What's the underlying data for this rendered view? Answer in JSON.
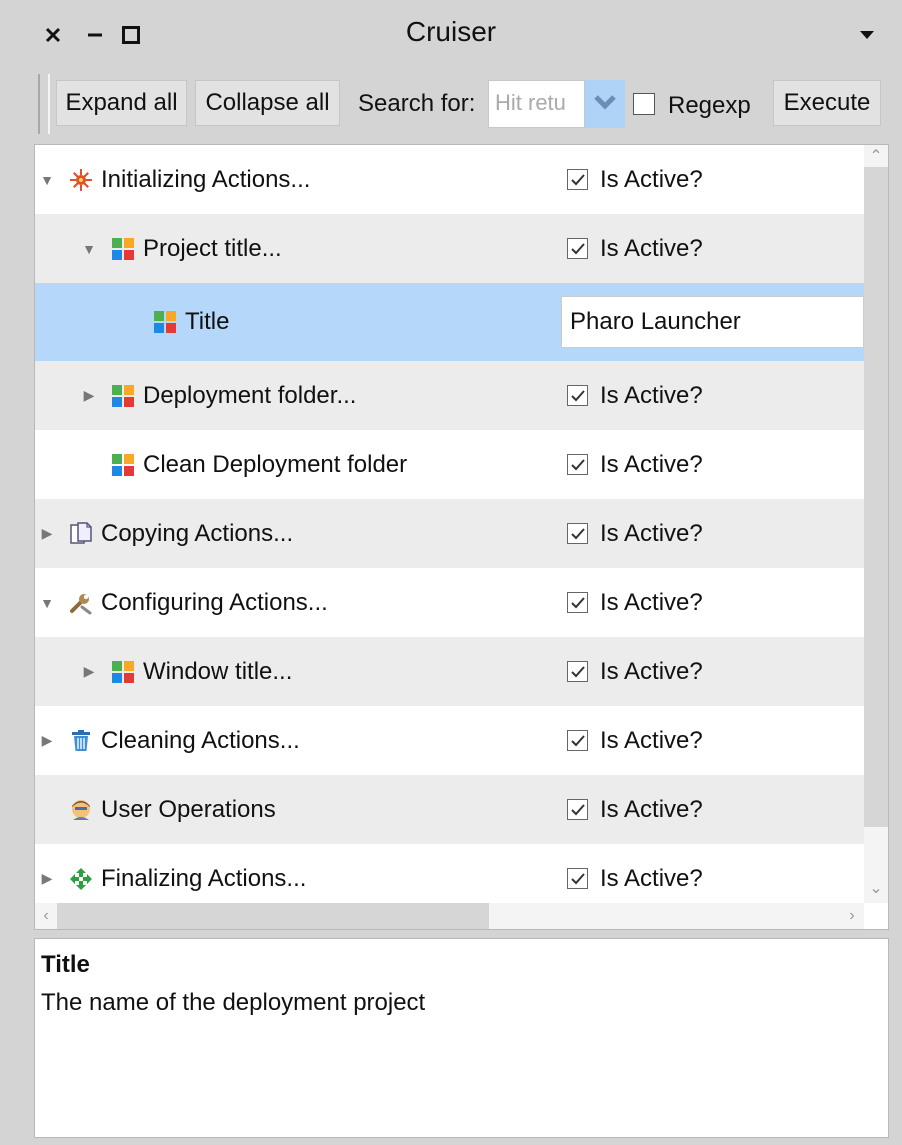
{
  "window": {
    "title": "Cruiser"
  },
  "toolbar": {
    "expand_all": "Expand all",
    "collapse_all": "Collapse all",
    "search_label": "Search for:",
    "search_placeholder": "Hit retu",
    "regexp_label": "Regexp",
    "regexp_checked": false,
    "execute": "Execute"
  },
  "tree": {
    "active_label": "Is Active?",
    "rows": [
      {
        "label": "Initializing Actions...",
        "level": 0,
        "expander": "expanded",
        "icon": "gear-burst-icon",
        "active": true
      },
      {
        "label": "Project title...",
        "level": 1,
        "expander": "expanded",
        "icon": "color-grid-icon",
        "active": true
      },
      {
        "label": "Title",
        "level": 2,
        "expander": "none",
        "icon": "color-grid-icon",
        "value": "Pharo Launcher",
        "selected": true
      },
      {
        "label": "Deployment folder...",
        "level": 1,
        "expander": "collapsed",
        "icon": "color-grid-icon",
        "active": true
      },
      {
        "label": "Clean Deployment folder",
        "level": 1,
        "expander": "none",
        "icon": "color-grid-icon",
        "active": true
      },
      {
        "label": "Copying Actions...",
        "level": 0,
        "expander": "collapsed",
        "icon": "copy-document-icon",
        "active": true
      },
      {
        "label": "Configuring Actions...",
        "level": 0,
        "expander": "expanded",
        "icon": "wrench-icon",
        "active": true
      },
      {
        "label": "Window title...",
        "level": 1,
        "expander": "collapsed",
        "icon": "color-grid-icon",
        "active": true
      },
      {
        "label": "Cleaning Actions...",
        "level": 0,
        "expander": "collapsed",
        "icon": "trash-icon",
        "active": true
      },
      {
        "label": "User Operations",
        "level": 0,
        "expander": "none",
        "icon": "user-icon",
        "active": true
      },
      {
        "label": "Finalizing Actions...",
        "level": 0,
        "expander": "collapsed",
        "icon": "green-arrows-icon",
        "active": true
      }
    ]
  },
  "description": {
    "title": "Title",
    "text": "The name of the deployment project"
  },
  "colors": {
    "selection": "#b5d7f9",
    "alt_row": "#ececec",
    "chrome": "#d4d4d4"
  }
}
